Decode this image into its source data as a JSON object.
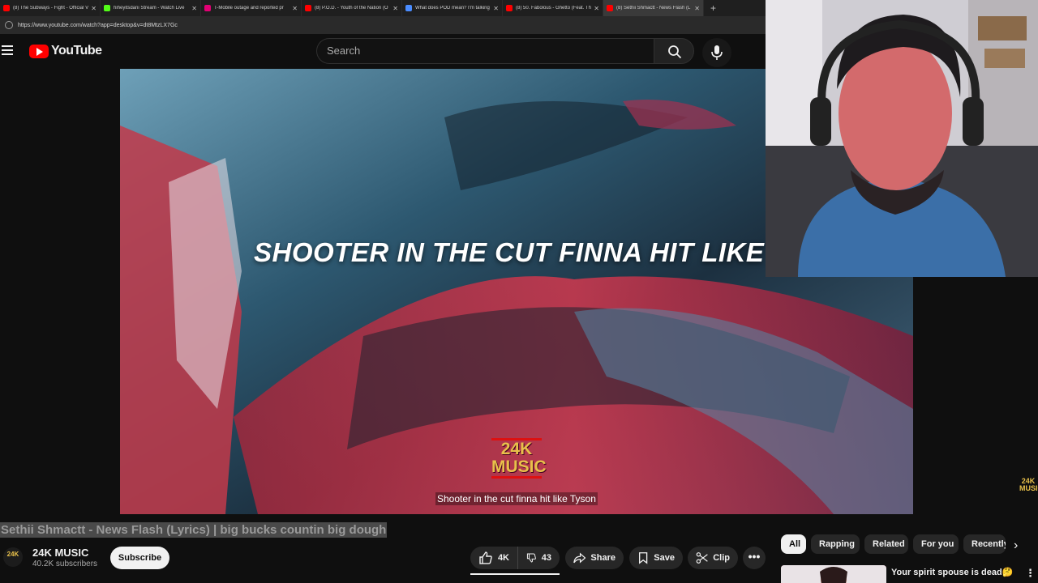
{
  "browser": {
    "tabs": [
      {
        "title": "(8) The Subways - Fight - Official V",
        "color": "#ff0000"
      },
      {
        "title": "hiheyitsdani Stream - Watch Live",
        "color": "#53fc18"
      },
      {
        "title": "T-Mobile outage and reported pr",
        "color": "#e20074"
      },
      {
        "title": "(8) P.O.D. - Youth of the Nation (O",
        "color": "#ff0000"
      },
      {
        "title": "What does POD mean? I'm talking",
        "color": "#4a8cff"
      },
      {
        "title": "(8) 50. Fabolous - Ghetto (Feat. Th",
        "color": "#ff0000"
      },
      {
        "title": "(8) Sethii Shmactt - News Flash (L",
        "color": "#ff0000"
      }
    ],
    "new_tab": "+",
    "url": "https://www.youtube.com/watch?app=desktop&v=dt8MtzLX7Gc"
  },
  "header": {
    "logo_text": "YouTube",
    "search_placeholder": "Search"
  },
  "video": {
    "lyric_overlay": "SHOOTER IN THE CUT FINNA HIT LIKE TYSON",
    "watermark_line1": "24K",
    "watermark_line2": "MUSIC",
    "caption": "Shooter in the cut finna hit like Tyson",
    "side_watermark_1": "24K",
    "side_watermark_2": "MUSIC"
  },
  "meta": {
    "title": "Sethii Shmactt - News Flash (Lyrics) | big bucks countin big dough",
    "channel_name": "24K MUSIC",
    "avatar_text": "24K",
    "subscribers": "40.2K subscribers",
    "subscribe_label": "Subscribe",
    "likes": "4K",
    "dislikes": "43",
    "share_label": "Share",
    "save_label": "Save",
    "clip_label": "Clip",
    "more_label": "•••"
  },
  "chips": [
    "All",
    "Rapping",
    "Related",
    "For you",
    "Recently uploaded"
  ],
  "chip_next": "›",
  "recommendation": {
    "title": "Your spirit spouse is dead🤔",
    "more": "⋮"
  }
}
